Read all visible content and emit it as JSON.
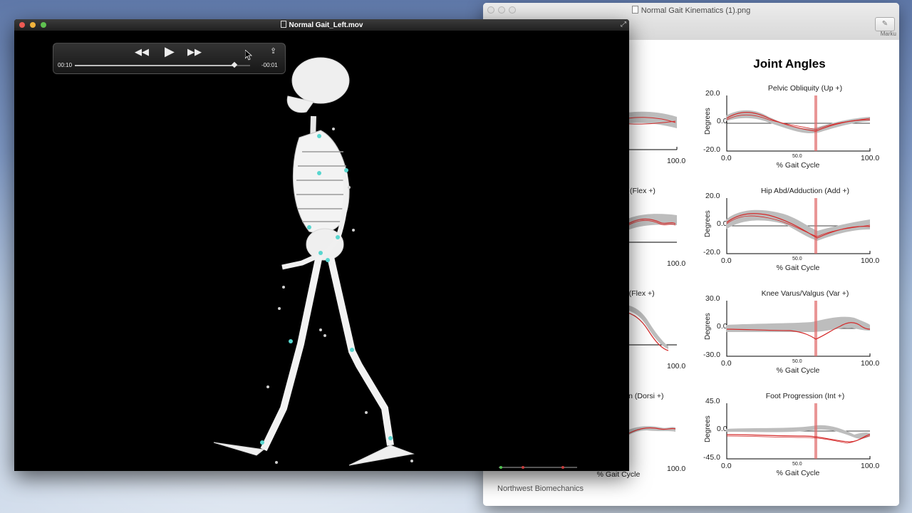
{
  "preview": {
    "title": "Normal Gait Kinematics (1).png",
    "markup_label": "Marku",
    "heading": "Joint Angles",
    "footer": "Northwest Biomechanics",
    "x_label": "% Gait Cycle",
    "x_min": "0.0",
    "x_mid": "50.0",
    "x_max": "100.0",
    "y_label": "Degrees",
    "left_graphs": [
      {
        "title": ""
      },
      {
        "title": "(Flex +)"
      },
      {
        "title": "n (Flex +)"
      },
      {
        "title": "ion (Dorsi +)"
      }
    ],
    "right_graphs": [
      {
        "title": "Pelvic Obliquity (Up +)",
        "y_max": "20.0",
        "y_zero": "0.0",
        "y_min": "-20.0"
      },
      {
        "title": "Hip Abd/Adduction (Add +)",
        "y_max": "20.0",
        "y_zero": "0.0",
        "y_min": "-20.0"
      },
      {
        "title": "Knee Varus/Valgus (Var +)",
        "y_max": "30.0",
        "y_zero": "0.0",
        "y_min": "-30.0"
      },
      {
        "title": "Foot Progression (Int +)",
        "y_max": "45.0",
        "y_zero": "0.0",
        "y_min": "-45.0"
      }
    ]
  },
  "player": {
    "title": "Normal Gait_Left.mov",
    "elapsed": "00:10",
    "remaining": "-00:01",
    "progress": 0.91,
    "icons": {
      "rewind": "rewind-icon",
      "play": "play-icon",
      "fast_forward": "fast-forward-icon",
      "share": "share-icon",
      "fullscreen": "fullscreen-icon"
    }
  },
  "colors": {
    "subject_trace": "#d42a2a",
    "normal_band": "#bdbdbd",
    "toe_off_marker": "#e06a6a",
    "skeleton": "#f2f2f2",
    "markers": "#58d6cf"
  }
}
